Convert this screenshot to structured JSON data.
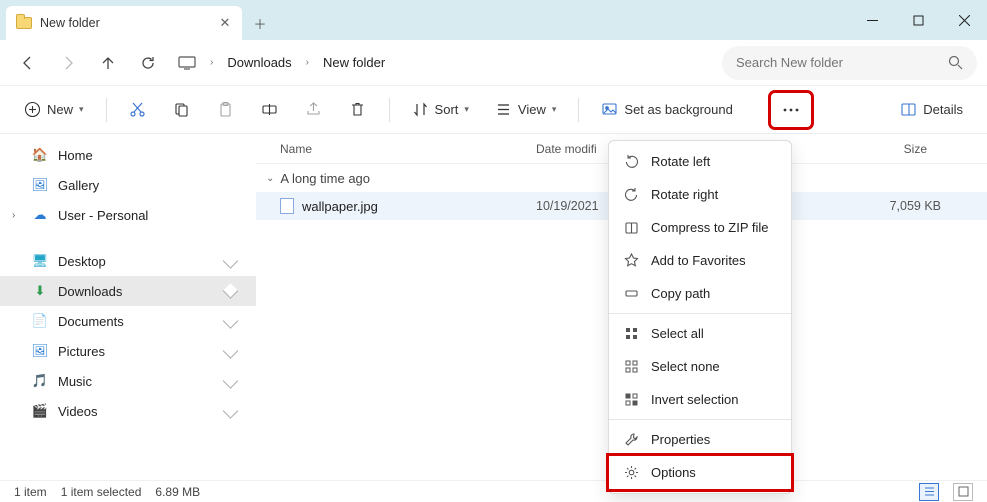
{
  "tab": {
    "title": "New folder"
  },
  "breadcrumb": [
    "Downloads",
    "New folder"
  ],
  "search": {
    "placeholder": "Search New folder"
  },
  "toolbar": {
    "new": "New",
    "sort": "Sort",
    "view": "View",
    "set_bg": "Set as background",
    "details": "Details"
  },
  "sidebar": {
    "home": "Home",
    "gallery": "Gallery",
    "user": "User - Personal",
    "desktop": "Desktop",
    "downloads": "Downloads",
    "documents": "Documents",
    "pictures": "Pictures",
    "music": "Music",
    "videos": "Videos"
  },
  "columns": {
    "name": "Name",
    "modified": "Date modifi",
    "type": "",
    "size": "Size"
  },
  "group_label": "A long time ago",
  "file": {
    "name": "wallpaper.jpg",
    "modified": "10/19/2021",
    "size": "7,059 KB"
  },
  "menu": {
    "rotate_left": "Rotate left",
    "rotate_right": "Rotate right",
    "compress": "Compress to ZIP file",
    "favorites": "Add to Favorites",
    "copy_path": "Copy path",
    "select_all": "Select all",
    "select_none": "Select none",
    "invert": "Invert selection",
    "properties": "Properties",
    "options": "Options"
  },
  "status": {
    "count": "1 item",
    "selected": "1 item selected",
    "size": "6.89 MB"
  }
}
